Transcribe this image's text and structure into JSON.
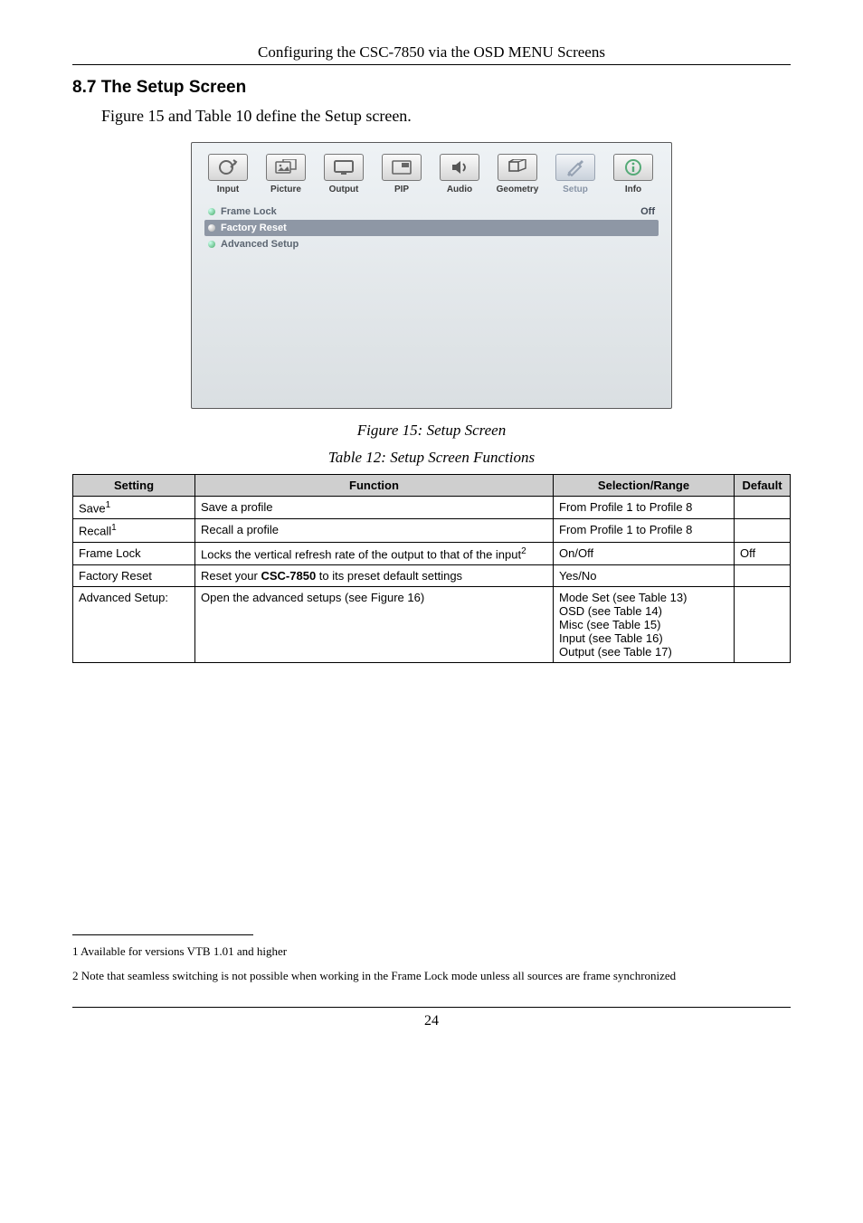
{
  "header": {
    "running_head": "Configuring the CSC-7850 via the OSD MENU Screens"
  },
  "section": {
    "number": "8.7",
    "title": "The Setup Screen",
    "intro": "Figure 15 and Table 10 define the Setup screen."
  },
  "osd": {
    "tabs": [
      {
        "label": "Input",
        "icon": "input-icon"
      },
      {
        "label": "Picture",
        "icon": "picture-icon"
      },
      {
        "label": "Output",
        "icon": "output-icon"
      },
      {
        "label": "PIP",
        "icon": "pip-icon"
      },
      {
        "label": "Audio",
        "icon": "audio-icon"
      },
      {
        "label": "Geometry",
        "icon": "geometry-icon"
      },
      {
        "label": "Setup",
        "icon": "setup-icon",
        "active": true
      },
      {
        "label": "Info",
        "icon": "info-icon"
      }
    ],
    "rows": [
      {
        "label": "Frame Lock",
        "value": "Off",
        "state": "normal"
      },
      {
        "label": "Factory Reset",
        "value": "",
        "state": "selected"
      },
      {
        "label": "Advanced Setup",
        "value": "",
        "state": "normal"
      }
    ]
  },
  "captions": {
    "figure": "Figure 15: Setup Screen",
    "table": "Table 12: Setup Screen Functions"
  },
  "table": {
    "headers": {
      "setting": "Setting",
      "function": "Function",
      "selrange": "Selection/Range",
      "default": "Default"
    },
    "rows": [
      {
        "setting": "Save",
        "setting_sup": "1",
        "function_pre": "Save a profile",
        "function_bold": "",
        "function_post": "",
        "selrange": "From Profile 1 to Profile 8",
        "default": ""
      },
      {
        "setting": "Recall",
        "setting_sup": "1",
        "function_pre": "Recall a profile",
        "function_bold": "",
        "function_post": "",
        "selrange": "From Profile 1 to Profile 8",
        "default": ""
      },
      {
        "setting": "Frame Lock",
        "setting_sup": "",
        "function_pre": "Locks the vertical refresh rate of the output to that of the input",
        "function_bold": "",
        "function_post": "",
        "function_sup": "2",
        "selrange": "On/Off",
        "default": "Off"
      },
      {
        "setting": "Factory Reset",
        "setting_sup": "",
        "function_pre": "Reset your ",
        "function_bold": "CSC-7850",
        "function_post": " to its preset default settings",
        "selrange": "Yes/No",
        "default": ""
      },
      {
        "setting": "Advanced Setup:",
        "setting_sup": "",
        "function_pre": "Open the advanced setups (see Figure 16)",
        "function_bold": "",
        "function_post": "",
        "selrange": "Mode Set (see Table 13)\nOSD (see Table 14)\nMisc (see Table 15)\nInput (see Table 16)\nOutput (see Table 17)",
        "default": ""
      }
    ]
  },
  "footnotes": {
    "f1": "1 Available for versions VTB 1.01 and higher",
    "f2": "2  Note  that  seamless  switching  is  not  possible  when  working  in  the  Frame  Lock  mode  unless  all  sources  are  frame synchronized"
  },
  "page_number": "24"
}
